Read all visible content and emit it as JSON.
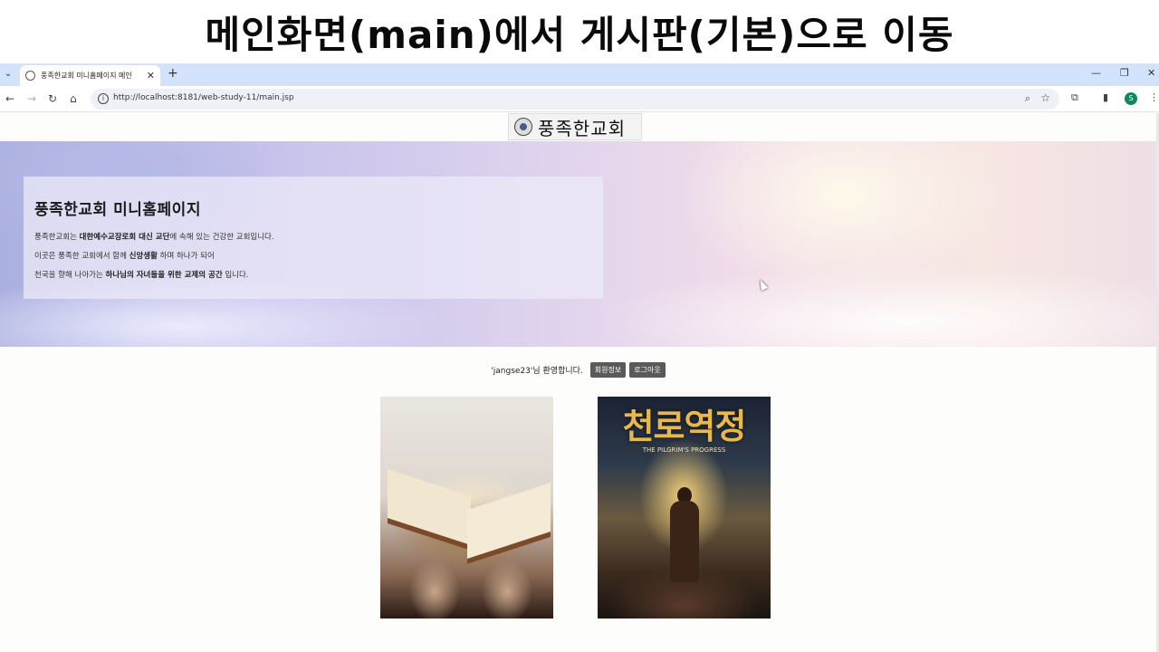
{
  "slide": {
    "title": "메인화면(main)에서 게시판(기본)으로 이동"
  },
  "browser": {
    "tab_title": "풍족한교회 미니홈페이지 메인",
    "url": "http://localhost:8181/web-study-11/main.jsp",
    "profile_initial": "S",
    "icons": [
      "chevron-down-icon",
      "globe-icon",
      "close-icon",
      "plus-icon",
      "back-icon",
      "forward-icon",
      "reload-icon",
      "home-icon",
      "info-icon",
      "zoom-icon",
      "star-icon",
      "extensions-icon",
      "sidepanel-icon",
      "menu-icon",
      "minimize-icon",
      "restore-icon",
      "window-close-icon"
    ]
  },
  "page": {
    "logo_text": "풍족한교회",
    "hero": {
      "title": "풍족한교회 미니홈페이지",
      "line1_a": "풍족한교회는 ",
      "line1_b": "대한예수교장로회 대신 교단",
      "line1_c": "에 속해 있는 건강한 교회입니다.",
      "line2_a": "이곳은 풍족한 교회에서 함께 ",
      "line2_b": "신앙생활",
      "line2_c": " 하며 하나가 되어",
      "line3_a": "천국을 향해 나아가는 ",
      "line3_b": "하나님의 자녀들을 위한 교제의 공간",
      "line3_c": " 입니다."
    },
    "welcome": "'jangse23'님 환영합니다.",
    "member_info_button": "회원정보",
    "logout_button": "로그아웃",
    "cards": {
      "pilgrim_title": "천로역정",
      "pilgrim_subtitle": "THE PILGRIM'S PROGRESS"
    }
  }
}
